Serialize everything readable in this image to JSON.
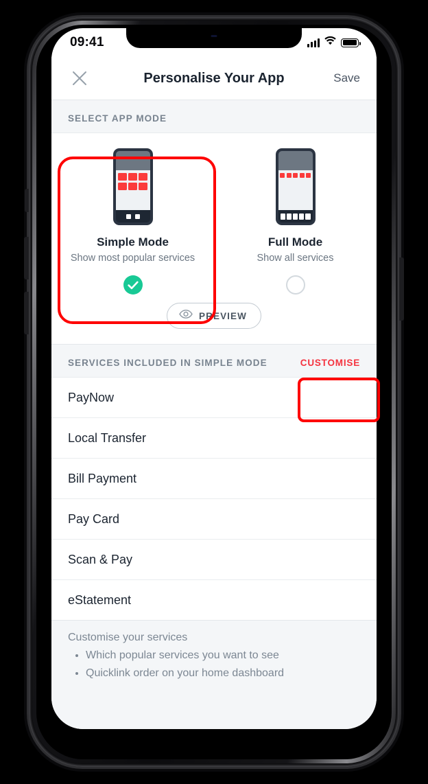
{
  "status_bar": {
    "time": "09:41",
    "signal_icon": "signal-bars-icon",
    "wifi_icon": "wifi-icon",
    "battery_icon": "battery-full-icon"
  },
  "nav": {
    "close_icon": "close-x-icon",
    "title": "Personalise Your App",
    "save_label": "Save"
  },
  "mode_section": {
    "header": "SELECT APP MODE",
    "modes": [
      {
        "title": "Simple Mode",
        "subtitle": "Show most popular services",
        "selected": true,
        "selection_icon": "check-circle-icon",
        "illustration": "phone-grid-3x2-icon"
      },
      {
        "title": "Full Mode",
        "subtitle": "Show all services",
        "selected": false,
        "selection_icon": "empty-circle-icon",
        "illustration": "phone-row-5-icon"
      }
    ],
    "preview_label": "PREVIEW",
    "preview_icon": "eye-icon"
  },
  "services_section": {
    "header": "SERVICES INCLUDED IN SIMPLE MODE",
    "customise_label": "CUSTOMISE",
    "items": [
      "PayNow",
      "Local Transfer",
      "Bill Payment",
      "Pay Card",
      "Scan & Pay",
      "eStatement"
    ]
  },
  "footer": {
    "title": "Customise your services",
    "bullets": [
      "Which popular services you want to see",
      "Quicklink order on your home dashboard"
    ]
  },
  "colors": {
    "brand_red": "#f5333f",
    "annotation_red": "#fe0000",
    "success_green": "#18c995",
    "tile_red": "#fb3b3b",
    "text_dark": "#1b2430",
    "text_muted": "#78838f",
    "section_bg": "#f4f6f8"
  }
}
